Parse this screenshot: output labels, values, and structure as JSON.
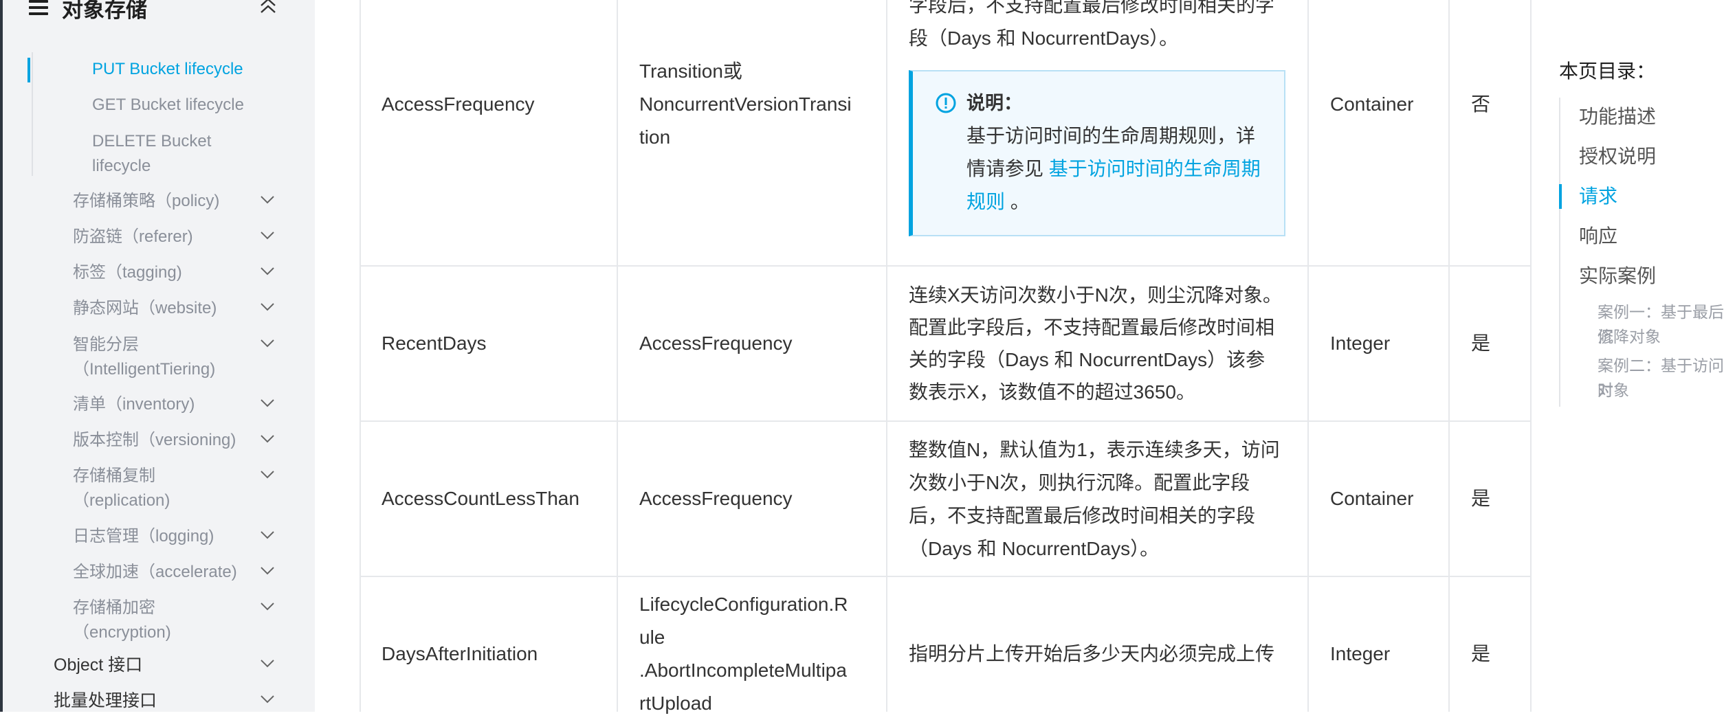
{
  "sidebar": {
    "title": "对象存储",
    "items": [
      {
        "label": "PUT Bucket lifecycle"
      },
      {
        "label": "GET Bucket lifecycle"
      },
      {
        "label": "DELETE Bucket"
      },
      {
        "label": "lifecycle"
      },
      {
        "label": "存储桶策略（policy)"
      },
      {
        "label": "防盗链（referer)"
      },
      {
        "label": "标签（tagging)"
      },
      {
        "label": "静态网站（website)"
      },
      {
        "label": "智能分层"
      },
      {
        "label": "（IntelligentTiering)"
      },
      {
        "label": "清单（inventory)"
      },
      {
        "label": "版本控制（versioning)"
      },
      {
        "label": "存储桶复制"
      },
      {
        "label": "（replication)"
      },
      {
        "label": "日志管理（logging)"
      },
      {
        "label": "全球加速（accelerate)"
      },
      {
        "label": "存储桶加密"
      },
      {
        "label": "（encryption)"
      },
      {
        "label": "Object 接口"
      },
      {
        "label": "批量处理接口"
      }
    ]
  },
  "table": {
    "rows": [
      {
        "name": "AccessFrequency",
        "parent": [
          "Transition或",
          "NoncurrentVersionTransi",
          "tion"
        ],
        "desc": [
          "字段后，不支持配置最后修改时间相关的字",
          "段（Days 和 NocurrentDays）。"
        ],
        "type": "Container",
        "required": "否"
      },
      {
        "name": "RecentDays",
        "parent": [
          "AccessFrequency"
        ],
        "desc": [
          "连续X天访问次数小于N次，则尘沉降对象。",
          "配置此字段后，不支持配置最后修改时间相",
          "关的字段（Days 和 NocurrentDays）该参",
          "数表示X，该数值不的超过3650。"
        ],
        "type": "Integer",
        "required": "是"
      },
      {
        "name": "AccessCountLessThan",
        "parent": [
          "AccessFrequency"
        ],
        "desc": [
          "整数值N，默认值为1，表示连续多天，访问",
          "次数小于N次，则执行沉降。配置此字段",
          "后，不支持配置最后修改时间相关的字段",
          "（Days 和 NocurrentDays）。"
        ],
        "type": "Container",
        "required": "是"
      },
      {
        "name": "DaysAfterInitiation",
        "parent": [
          "LifecycleConfiguration.R",
          "ule",
          ".AbortIncompleteMultipa",
          "rtUpload"
        ],
        "desc": [
          "指明分片上传开始后多少天内必须完成上传"
        ],
        "type": "Integer",
        "required": "是"
      }
    ],
    "note": {
      "title": "说明：",
      "body_1": "基于访问时间的生命周期规则，详",
      "body_2": "情请参见",
      "link_1": "基于访问时间的生命周期",
      "link_2": "规则",
      "tail": "。"
    }
  },
  "toc": {
    "title": "本页目录：",
    "items": [
      "功能描述",
      "授权说明",
      "请求",
      "响应",
      "实际案例"
    ],
    "subitems": [
      "案例一：基于最后修",
      "沉降对象",
      "案例二：基于访问时",
      "对象"
    ]
  },
  "colors": {
    "accent": "#00a3e0",
    "sidebar_bg": "#f2f3f5",
    "note_bg": "#f1f9fe"
  }
}
